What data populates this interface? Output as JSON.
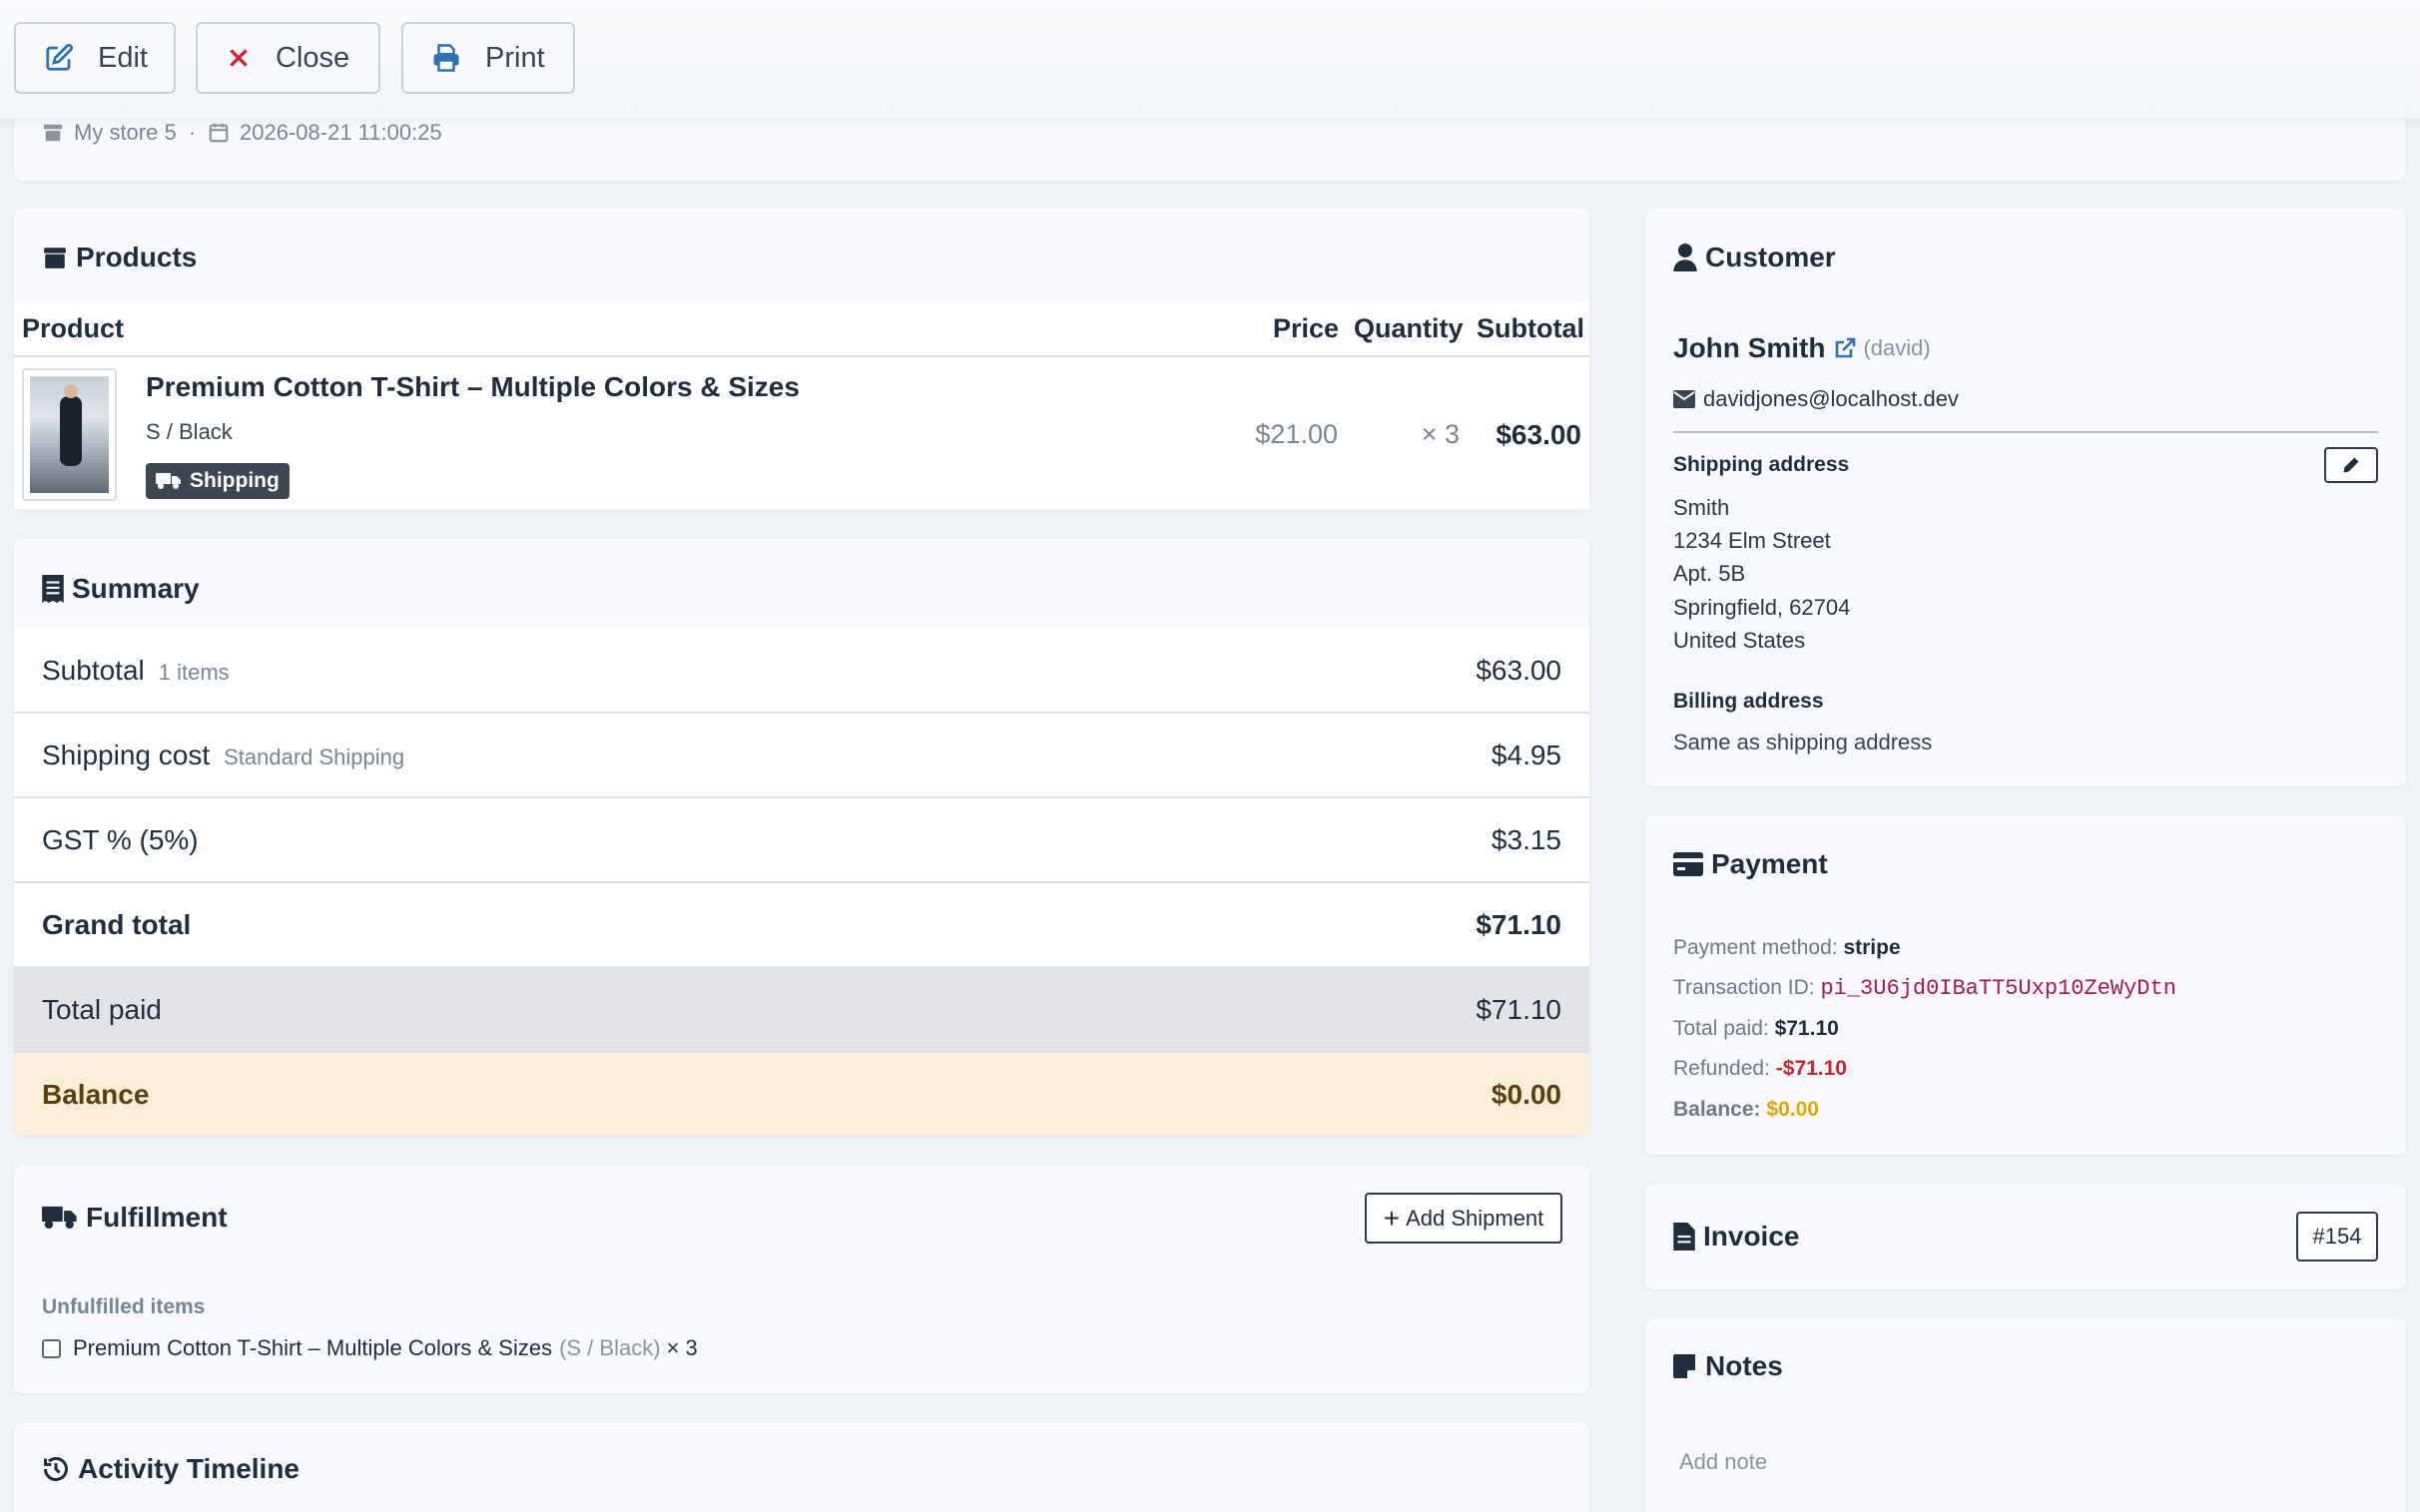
{
  "toolbar": {
    "edit_label": "Edit",
    "close_label": "Close",
    "print_label": "Print"
  },
  "meta": {
    "store": "My store 5",
    "separator": "·",
    "datetime": "2026-08-21 11:00:25"
  },
  "products": {
    "title": "Products",
    "columns": [
      "Product",
      "Price",
      "Quantity",
      "Subtotal"
    ],
    "items": [
      {
        "name": "Premium Cotton T-Shirt – Multiple Colors & Sizes",
        "variant": "S / Black",
        "badge": "Shipping",
        "price": "$21.00",
        "quantity": "× 3",
        "subtotal": "$63.00"
      }
    ]
  },
  "summary": {
    "title": "Summary",
    "subtotal_label": "Subtotal",
    "subtotal_note": "1 items",
    "subtotal_value": "$63.00",
    "shipping_label": "Shipping cost",
    "shipping_note": "Standard Shipping",
    "shipping_value": "$4.95",
    "tax_label": "GST % (5%)",
    "tax_value": "$3.15",
    "grand_label": "Grand total",
    "grand_value": "$71.10",
    "paid_label": "Total paid",
    "paid_value": "$71.10",
    "balance_label": "Balance",
    "balance_value": "$0.00"
  },
  "fulfillment": {
    "title": "Fulfillment",
    "add_button": "Add Shipment",
    "unfulfilled_label": "Unfulfilled items",
    "item_name": "Premium Cotton T-Shirt – Multiple Colors & Sizes",
    "item_variant": "(S / Black)",
    "item_qty": "× 3"
  },
  "activity": {
    "title": "Activity Timeline"
  },
  "customer": {
    "title": "Customer",
    "name": "John Smith",
    "username": "(david)",
    "email": "davidjones@localhost.dev",
    "shipping_label": "Shipping address",
    "address": [
      "Smith",
      "1234 Elm Street",
      "Apt. 5B",
      "Springfield, 62704",
      "United States"
    ],
    "billing_label": "Billing address",
    "billing_value": "Same as shipping address"
  },
  "payment": {
    "title": "Payment",
    "method_label": "Payment method:",
    "method_value": "stripe",
    "txn_label": "Transaction ID:",
    "txn_value": "pi_3U6jd0IBaTT5Uxp10ZeWyDtn",
    "paid_label": "Total paid:",
    "paid_value": "$71.10",
    "refunded_label": "Refunded:",
    "refunded_value": "-$71.10",
    "balance_label": "Balance:",
    "balance_value": "$0.00"
  },
  "invoice": {
    "title": "Invoice",
    "number": "#154"
  },
  "notes": {
    "title": "Notes",
    "placeholder": "Add note"
  },
  "colors": {
    "accent_blue": "#2f6fb5",
    "close_red": "#d6222c",
    "refund_red": "#c82333",
    "balance_yellow": "#e0a800",
    "txn_pink": "#a3195b",
    "balance_row_bg": "#fbeed9",
    "paid_row_bg": "#e1e3e6"
  }
}
